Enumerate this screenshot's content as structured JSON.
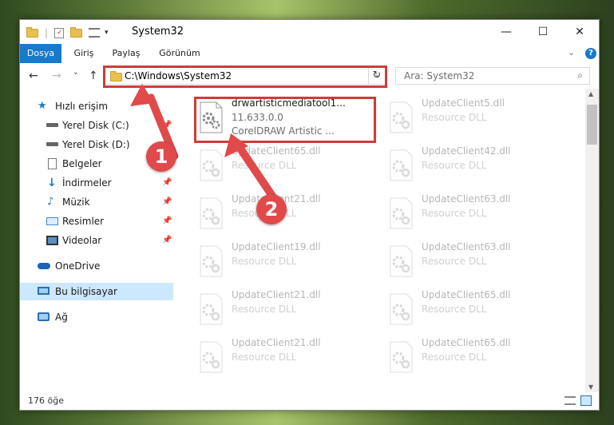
{
  "window": {
    "title": "System32",
    "controls": {
      "minimize": "—",
      "maximize": "☐",
      "close": "✕"
    }
  },
  "ribbon": {
    "tabs": [
      {
        "label": "Dosya",
        "active": true
      },
      {
        "label": "Giriş",
        "active": false
      },
      {
        "label": "Paylaş",
        "active": false
      },
      {
        "label": "Görünüm",
        "active": false
      }
    ],
    "collapse_icon": "chevron-down-icon",
    "help_icon": "help-icon",
    "help_label": "?"
  },
  "navigation": {
    "back_icon": "←",
    "forward_icon": "→",
    "recent_icon": "˅",
    "up_icon": "↑",
    "address": "C:\\Windows\\System32",
    "refresh_icon": "↻",
    "search_placeholder": "Ara: System32"
  },
  "sidebar": {
    "items": [
      {
        "label": "Hızlı erişim",
        "icon": "star-icon",
        "pinned": false
      },
      {
        "label": "Yerel Disk (C:)",
        "icon": "drive-icon",
        "pinned": true
      },
      {
        "label": "Yerel Disk (D:)",
        "icon": "drive-icon",
        "pinned": true
      },
      {
        "label": "Belgeler",
        "icon": "document-icon",
        "pinned": true
      },
      {
        "label": "İndirmeler",
        "icon": "download-icon",
        "pinned": true
      },
      {
        "label": "Müzik",
        "icon": "music-icon",
        "pinned": true
      },
      {
        "label": "Resimler",
        "icon": "picture-icon",
        "pinned": true
      },
      {
        "label": "Videolar",
        "icon": "video-icon",
        "pinned": true
      },
      {
        "label": "OneDrive",
        "icon": "cloud-icon",
        "pinned": false
      },
      {
        "label": "Bu bilgisayar",
        "icon": "computer-icon",
        "pinned": false,
        "selected": true
      },
      {
        "label": "Ağ",
        "icon": "network-icon",
        "pinned": false
      }
    ]
  },
  "files": [
    {
      "name": "drwartisticmediatool1...",
      "version": "11.633.0.0",
      "description": "CorelDRAW Artistic ...",
      "highlighted": true
    },
    {
      "name": "UpdateClient5.dll",
      "description": "Resource DLL"
    },
    {
      "name": "UpdateClient65.dll",
      "description": "Resource DLL"
    },
    {
      "name": "UpdateClient42.dll",
      "description": "Resource DLL"
    },
    {
      "name": "UpdateClient21.dll",
      "description": "Resource DLL"
    },
    {
      "name": "UpdateClient63.dll",
      "description": "Resource DLL"
    },
    {
      "name": "UpdateClient19.dll",
      "description": "Resource DLL"
    },
    {
      "name": "UpdateClient63.dll",
      "description": "Resource DLL"
    },
    {
      "name": "UpdateClient21.dll",
      "description": "Resource DLL"
    },
    {
      "name": "UpdateClient65.dll",
      "description": "Resource DLL"
    },
    {
      "name": "UpdateClient21.dll",
      "description": "Resource DLL"
    },
    {
      "name": "UpdateClient65.dll",
      "description": "Resource DLL"
    }
  ],
  "status": {
    "item_count": "176 öğe"
  },
  "annotations": [
    {
      "label": "1"
    },
    {
      "label": "2"
    }
  ],
  "colors": {
    "accent": "#1979ca",
    "selected_bg": "#cce8ff",
    "annotation": "#e04a4a"
  }
}
